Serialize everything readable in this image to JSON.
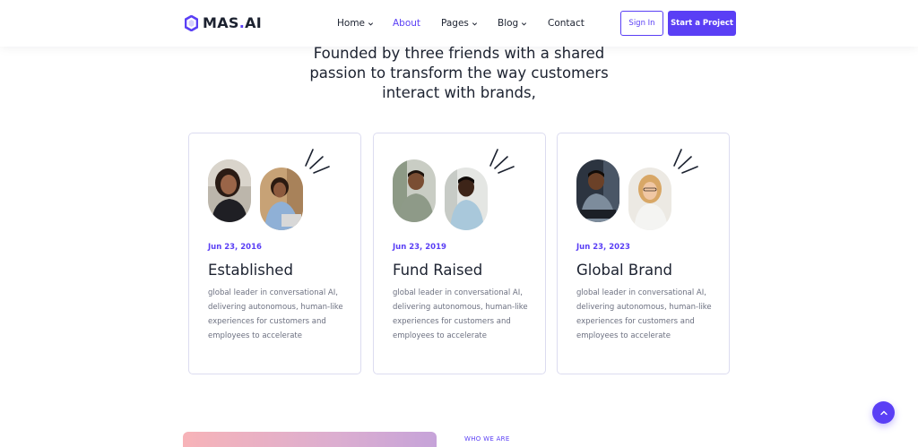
{
  "header": {
    "logo": {
      "name": "MAS",
      "dot": ".",
      "suffix": "AI"
    },
    "nav": [
      {
        "label": "Home",
        "dropdown": true,
        "active": false
      },
      {
        "label": "About",
        "dropdown": false,
        "active": true
      },
      {
        "label": "Pages",
        "dropdown": true,
        "active": false
      },
      {
        "label": "Blog",
        "dropdown": true,
        "active": false
      },
      {
        "label": "Contact",
        "dropdown": false,
        "active": false
      }
    ],
    "signin_label": "Sign In",
    "start_label": "Start a Project"
  },
  "headline": "Founded by three friends with a shared passion to transform the way customers interact with brands,",
  "cards": [
    {
      "date": "Jun 23, 2016",
      "title": "Established",
      "desc": "global leader in conversational AI, delivering autonomous, human-like experiences for customers and employees to accelerate"
    },
    {
      "date": "Jun 23, 2019",
      "title": "Fund Raised",
      "desc": "global leader in conversational AI, delivering autonomous, human-like experiences for customers and employees to accelerate"
    },
    {
      "date": "Jun 23, 2023",
      "title": "Global Brand",
      "desc": "global leader in conversational AI, delivering autonomous, human-like experiences for customers and employees to accelerate"
    }
  ],
  "who_we_are": "WHO WE ARE",
  "colors": {
    "accent": "#5a3ff5",
    "text": "#1c2230",
    "muted": "#6c7080",
    "card_border": "#dcdcf0"
  },
  "icons": {
    "logo": "hexagon-logo-icon",
    "chevron": "chevron-down-icon",
    "scroll_top": "chevron-up-icon",
    "burst": "burst-lines-icon"
  }
}
